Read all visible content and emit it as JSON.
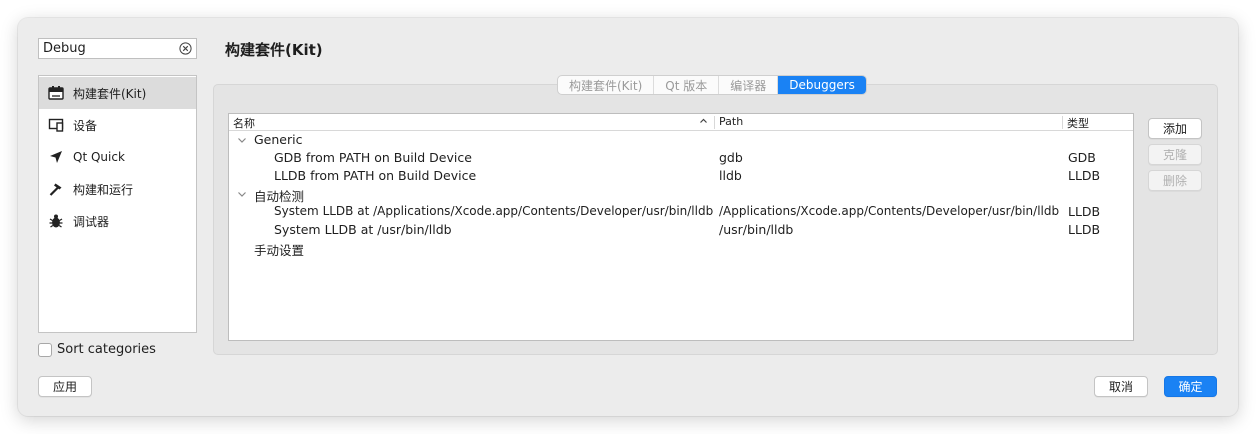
{
  "search": {
    "value": "Debug"
  },
  "sidebar": {
    "items": [
      {
        "label": "构建套件(Kit)",
        "icon": "kit-icon",
        "active": true
      },
      {
        "label": "设备",
        "icon": "device-icon",
        "active": false
      },
      {
        "label": "Qt Quick",
        "icon": "qtquick-icon",
        "active": false
      },
      {
        "label": "构建和运行",
        "icon": "hammer-icon",
        "active": false
      },
      {
        "label": "调试器",
        "icon": "bug-icon",
        "active": false
      }
    ]
  },
  "sort_categories": {
    "label": "Sort categories",
    "checked": false
  },
  "page_title": "构建套件(Kit)",
  "tabs": [
    {
      "label": "构建套件(Kit)",
      "active": false
    },
    {
      "label": "Qt 版本",
      "active": false
    },
    {
      "label": "编译器",
      "active": false
    },
    {
      "label": "Debuggers",
      "active": true
    }
  ],
  "table": {
    "columns": [
      "名称",
      "Path",
      "类型"
    ],
    "rows": [
      {
        "level": 0,
        "expanded": true,
        "name": "Generic",
        "path": "",
        "type": ""
      },
      {
        "level": 1,
        "name": "GDB from PATH on Build Device",
        "path": "gdb",
        "type": "GDB"
      },
      {
        "level": 1,
        "name": "LLDB from PATH on Build Device",
        "path": "lldb",
        "type": "LLDB"
      },
      {
        "level": 0,
        "expanded": true,
        "name": "自动检测",
        "path": "",
        "type": ""
      },
      {
        "level": 1,
        "name": "System LLDB at /Applications/Xcode.app/Contents/Developer/usr/bin/lldb",
        "path": "/Applications/Xcode.app/Contents/Developer/usr/bin/lldb",
        "type": "LLDB"
      },
      {
        "level": 1,
        "name": "System LLDB at /usr/bin/lldb",
        "path": "/usr/bin/lldb",
        "type": "LLDB"
      },
      {
        "level": 0,
        "expanded": false,
        "name": "手动设置",
        "path": "",
        "type": ""
      }
    ]
  },
  "actions": {
    "add": "添加",
    "clone": "克隆",
    "remove": "删除"
  },
  "footer": {
    "apply": "应用",
    "cancel": "取消",
    "ok": "确定"
  },
  "colors": {
    "accent": "#1a82f4",
    "window_bg": "#ececec",
    "selected_item": "#dcdcdc"
  }
}
